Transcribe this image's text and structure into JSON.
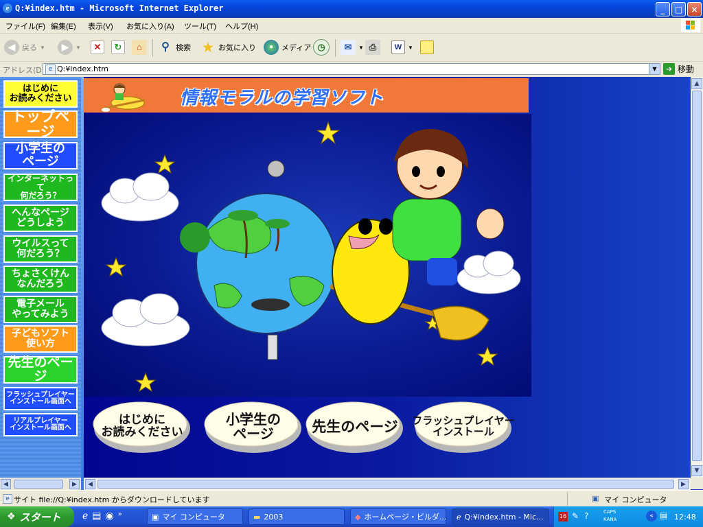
{
  "window": {
    "title": "Q:¥index.htm - Microsoft Internet Explorer",
    "controls": {
      "minimize": "_",
      "maximize": "□",
      "close": "×"
    }
  },
  "menubar": {
    "items": [
      "ファイル(F)",
      "編集(E)",
      "表示(V)",
      "お気に入り(A)",
      "ツール(T)",
      "ヘルプ(H)"
    ]
  },
  "toolbar": {
    "back_label": "戻る",
    "search_label": "検索",
    "favorites_label": "お気に入り",
    "media_label": "メディア"
  },
  "address": {
    "label": "アドレス(D)",
    "value": "Q:¥index.htm",
    "go_label": "移動"
  },
  "sidebar": {
    "items": [
      {
        "label": "はじめに\nお読みください",
        "bg": "#ffff33",
        "color": "#000000",
        "size": "13px"
      },
      {
        "label": "トップページ",
        "bg": "#ff9a1a",
        "color": "#ffffff",
        "size": "21px"
      },
      {
        "label": "小学生の\nページ",
        "bg": "#1f4dff",
        "color": "#ffffff",
        "size": "18px"
      },
      {
        "label": "インターネットって\n何だろう？",
        "bg": "#1fb81f",
        "color": "#ffffff",
        "size": "12px"
      },
      {
        "label": "へんなページ\nどうしよう",
        "bg": "#1fb81f",
        "color": "#ffffff",
        "size": "14px"
      },
      {
        "label": "ウイルスって\n何だろう？",
        "bg": "#1fb81f",
        "color": "#ffffff",
        "size": "14px"
      },
      {
        "label": "ちょさくけん\nなんだろう",
        "bg": "#1fb81f",
        "color": "#ffffff",
        "size": "14px"
      },
      {
        "label": "電子メール\nやってみよう",
        "bg": "#1fb81f",
        "color": "#ffffff",
        "size": "14px"
      },
      {
        "label": "子どもソフト\n使い方",
        "bg": "#ff9a1a",
        "color": "#ffffff",
        "size": "14px"
      },
      {
        "label": "先生のページ",
        "bg": "#2ad42a",
        "color": "#ffffff",
        "size": "19px"
      },
      {
        "label": "フラッシュプレイヤー\nインストール画面へ",
        "bg": "#1f4dff",
        "color": "#ffffff",
        "size": "10px"
      },
      {
        "label": "リアルプレイヤー\nインストール画面へ",
        "bg": "#1f4dff",
        "color": "#ffffff",
        "size": "10px"
      }
    ]
  },
  "banner": {
    "title": "情報モラルの学習ソフト"
  },
  "bottom_buttons": [
    {
      "label": "はじめに\nお読みください"
    },
    {
      "label": "小学生の\nページ"
    },
    {
      "label": "先生のページ"
    },
    {
      "label": "フラッシュプレイヤー\nインストール"
    }
  ],
  "statusbar": {
    "text": "サイト file://Q:¥index.htm からダウンロードしています",
    "zone": "マイ コンピュータ"
  },
  "taskbar": {
    "start": "スタート",
    "tasks": [
      "マイ コンピュータ",
      "2003",
      "ホームページ・ビルダ...",
      "Q:¥index.htm - Mic..."
    ],
    "tray_badge": "16",
    "tray_caps": "CAPS",
    "tray_kana": "KANA",
    "clock": "12:48"
  }
}
